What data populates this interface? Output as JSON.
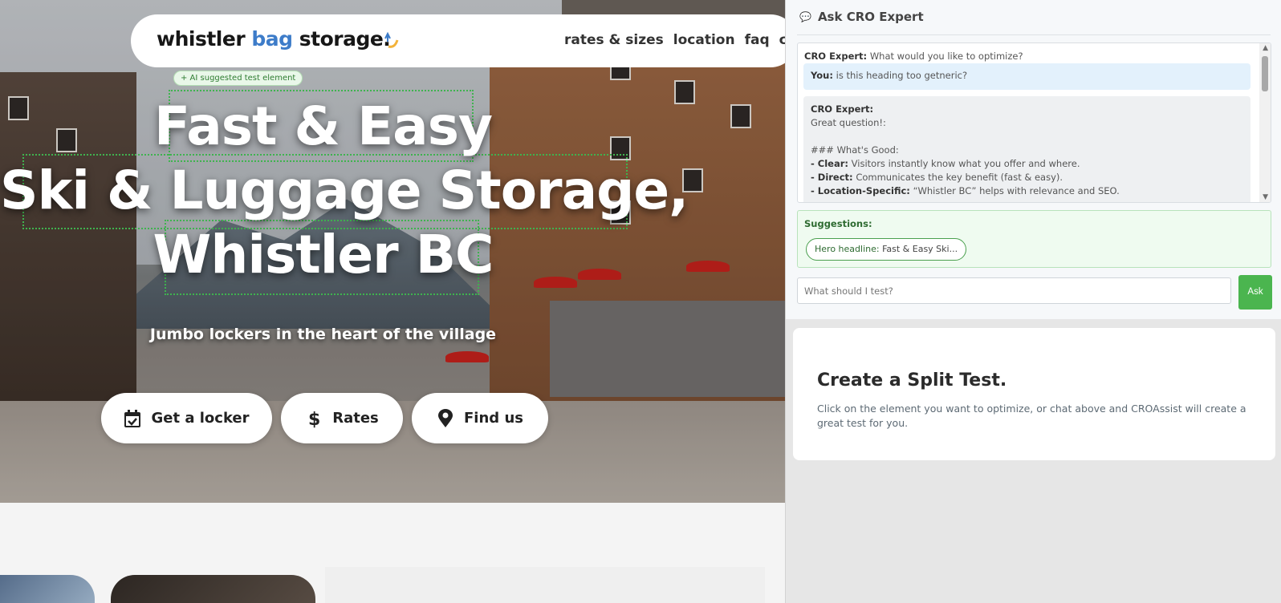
{
  "site": {
    "logo": {
      "part1": "whistler ",
      "part2": "bag",
      "part3": " storage."
    },
    "nav": [
      "rates & sizes",
      "location",
      "faq",
      "conta"
    ],
    "ai_badge": "+ AI suggested test element",
    "headline": [
      "Fast & Easy",
      "Ski & Luggage Storage,",
      "Whistler BC"
    ],
    "subheadline": "Jumbo lockers in the heart of the village",
    "cta": [
      {
        "label": "Get a locker",
        "icon": "calendar-check-icon"
      },
      {
        "label": "Rates",
        "icon": "dollar-icon"
      },
      {
        "label": "Find us",
        "icon": "map-pin-icon"
      }
    ],
    "colors": {
      "brand_blue": "#3d7cc9",
      "highlight_green": "#3fb34f"
    }
  },
  "panel": {
    "title": "Ask CRO Expert",
    "messages": [
      {
        "speaker": "CRO Expert:",
        "text": "What would you like to optimize?"
      },
      {
        "speaker": "You:",
        "text": "is this heading too getneric?"
      },
      {
        "speaker": "CRO Expert:",
        "lines": [
          {
            "bold": "",
            "text": "Great question!:"
          },
          {
            "bold": "",
            "text": ""
          },
          {
            "bold": "",
            "text": "### What's Good:"
          },
          {
            "bold": "- Clear:",
            "text": "Visitors instantly know what you offer and where."
          },
          {
            "bold": "- Direct:",
            "text": "Communicates the key benefit (fast & easy)."
          },
          {
            "bold": "- Location-Specific:",
            "text": "“Whistler BC” helps with relevance and SEO."
          }
        ]
      }
    ],
    "suggestions_title": "Suggestions:",
    "suggestion_chip": {
      "label": "Hero headline:",
      "text": "Fast & Easy Ski..."
    },
    "input_placeholder": "What should I test?",
    "ask_label": "Ask",
    "split_test": {
      "title": "Create a Split Test.",
      "description": "Click on the element you want to optimize, or chat above and CROAssist will create a great test for you."
    },
    "colors": {
      "ask_button": "#4bb54f",
      "user_bubble": "#e3f1fc",
      "suggestion_bg": "#effbf0"
    }
  }
}
